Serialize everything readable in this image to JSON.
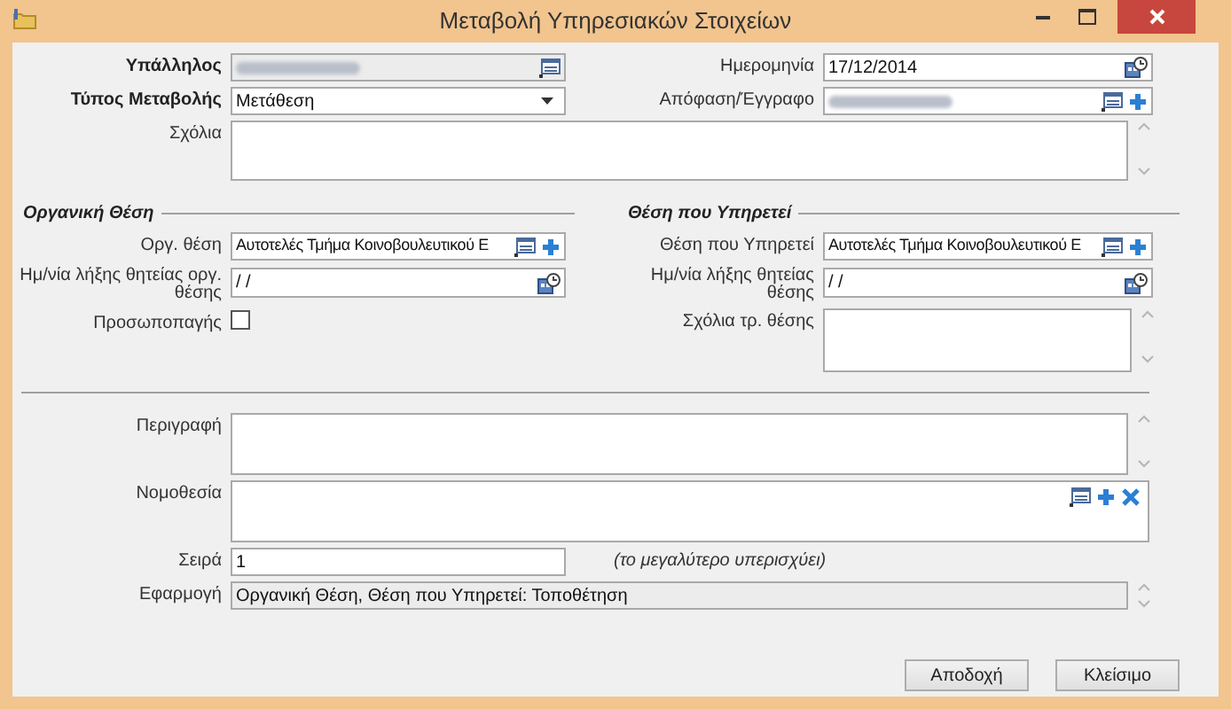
{
  "window": {
    "title": "Μεταβολή Υπηρεσιακών Στοιχείων"
  },
  "employee": {
    "label": "Υπάλληλος"
  },
  "date": {
    "label": "Ημερομηνία",
    "value": "17/12/2014"
  },
  "change_type": {
    "label": "Τύπος Μεταβολής",
    "value": "Μετάθεση"
  },
  "document": {
    "label": "Απόφαση/Έγγραφο"
  },
  "comments": {
    "label": "Σχόλια"
  },
  "organic_position": {
    "title": "Οργανική Θέση",
    "position": {
      "label": "Οργ. θέση",
      "value": "Αυτοτελές Τμήμα Κοινοβουλευτικού Ε"
    },
    "end_date": {
      "label": "Ημ/νία λήξης θητείας οργ. θέσης",
      "value": "/ /"
    },
    "personal": {
      "label": "Προσωποπαγής",
      "checked": false
    }
  },
  "serving_position": {
    "title": "Θέση που Υπηρετεί",
    "position": {
      "label": "Θέση που Υπηρετεί",
      "value": "Αυτοτελές Τμήμα Κοινοβουλευτικού Ε"
    },
    "end_date": {
      "label": "Ημ/νία λήξης θητείας θέσης",
      "value": "/ /"
    },
    "comments": {
      "label": "Σχόλια τρ. θέσης"
    }
  },
  "description": {
    "label": "Περιγραφή"
  },
  "legislation": {
    "label": "Νομοθεσία"
  },
  "order": {
    "label": "Σειρά",
    "value": "1",
    "hint": "(το μεγαλύτερο υπερισχύει)"
  },
  "application": {
    "label": "Εφαρμογή",
    "value": "Οργανική Θέση, Θέση που Υπηρετεί: Τοποθέτηση"
  },
  "buttons": [
    {
      "label": "Αποδοχή"
    },
    {
      "label": "Κλείσιμο"
    }
  ]
}
